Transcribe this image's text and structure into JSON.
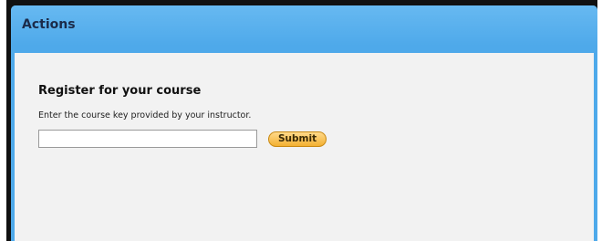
{
  "panel": {
    "title": "Actions"
  },
  "register": {
    "heading": "Register for your course",
    "instructions": "Enter the course key provided by your instructor.",
    "course_key_value": "",
    "submit_label": "Submit"
  },
  "colors": {
    "header_blue": "#4ea9ea",
    "body_background": "#f2f2f2",
    "submit_orange": "#f3b032"
  }
}
